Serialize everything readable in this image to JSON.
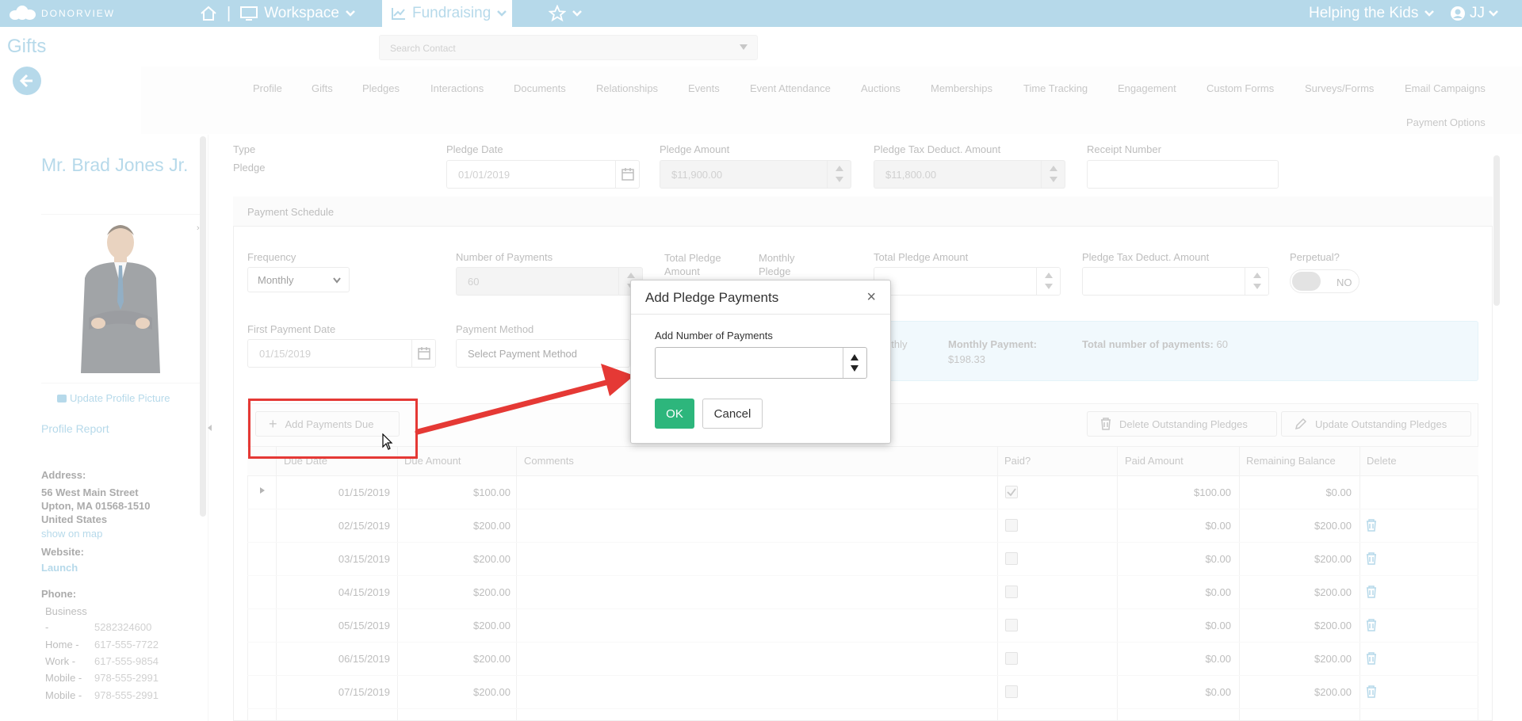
{
  "topnav": {
    "logo_text": "DONORVIEW",
    "home_sep": "|",
    "workspace": "Workspace",
    "fundraising": "Fundraising",
    "org": "Helping the Kids",
    "user": "JJ"
  },
  "page": {
    "title": "Gifts"
  },
  "search": {
    "placeholder": "Search Contact"
  },
  "tabs": [
    "Profile",
    "Gifts",
    "Pledges",
    "Interactions",
    "Documents",
    "Relationships",
    "Events",
    "Event Attendance",
    "Auctions",
    "Memberships",
    "Time Tracking",
    "Engagement",
    "Custom Forms",
    "Surveys/Forms",
    "Email Campaigns",
    "Payment Options"
  ],
  "sidebar": {
    "name": "Mr. Brad Jones Jr.",
    "update_pic": "Update Profile Picture",
    "profile_report": "Profile Report",
    "address_label": "Address:",
    "address_line1": "56 West Main Street",
    "address_line2": "Upton, MA 01568-1510",
    "address_line3": "United States",
    "show_map": "show on map",
    "website_label": "Website:",
    "website_link": "Launch",
    "phone_label": "Phone:",
    "phones": [
      {
        "type": "Business",
        "number": ""
      },
      {
        "type": "-",
        "number": "5282324600"
      },
      {
        "type": "Home -",
        "number": "617-555-7722"
      },
      {
        "type": "Work -",
        "number": "617-555-9854"
      },
      {
        "type": "Mobile -",
        "number": "978-555-2991"
      },
      {
        "type": "Mobile -",
        "number": "978-555-2991"
      }
    ]
  },
  "form": {
    "type_label": "Type",
    "type_value": "Pledge",
    "pledge_date_label": "Pledge Date",
    "pledge_date": "01/01/2019",
    "pledge_amount_label": "Pledge Amount",
    "pledge_amount": "$11,900.00",
    "tax_label": "Pledge Tax Deduct. Amount",
    "tax_amount": "$11,800.00",
    "receipt_label": "Receipt Number"
  },
  "schedule": {
    "header": "Payment Schedule",
    "frequency_label": "Frequency",
    "frequency": "Monthly",
    "num_payments_label": "Number of Payments",
    "num_payments": "60",
    "total_pledge_amount_small": "Total Pledge Amount",
    "monthly_pledge_small": "Monthly Pledge",
    "total_pledge_amount_label": "Total Pledge Amount",
    "tax_label": "Pledge Tax Deduct. Amount",
    "perpetual_label": "Perpetual?",
    "perpetual_value": "NO",
    "first_payment_label": "First Payment Date",
    "first_payment": "01/15/2019",
    "payment_method_label": "Payment Method",
    "payment_method": "Select Payment Method",
    "info_partial": "nthly",
    "monthly_payment_label": "Monthly Payment:",
    "monthly_payment": "$198.33",
    "total_payments_label": "Total number of payments:",
    "total_payments": "60"
  },
  "actions": {
    "add_due": "Add Payments Due",
    "delete_outstanding": "Delete Outstanding Pledges",
    "update_outstanding": "Update Outstanding Pledges"
  },
  "grid": {
    "headers": [
      "Due Date",
      "Due Amount",
      "Comments",
      "Paid?",
      "Paid Amount",
      "Remaining Balance",
      "Delete"
    ],
    "rows": [
      {
        "date": "01/15/2019",
        "amount": "$100.00",
        "paid": true,
        "paid_amount": "$100.00",
        "balance": "$0.00"
      },
      {
        "date": "02/15/2019",
        "amount": "$200.00",
        "paid": false,
        "paid_amount": "$0.00",
        "balance": "$200.00"
      },
      {
        "date": "03/15/2019",
        "amount": "$200.00",
        "paid": false,
        "paid_amount": "$0.00",
        "balance": "$200.00"
      },
      {
        "date": "04/15/2019",
        "amount": "$200.00",
        "paid": false,
        "paid_amount": "$0.00",
        "balance": "$200.00"
      },
      {
        "date": "05/15/2019",
        "amount": "$200.00",
        "paid": false,
        "paid_amount": "$0.00",
        "balance": "$200.00"
      },
      {
        "date": "06/15/2019",
        "amount": "$200.00",
        "paid": false,
        "paid_amount": "$0.00",
        "balance": "$200.00"
      },
      {
        "date": "07/15/2019",
        "amount": "$200.00",
        "paid": false,
        "paid_amount": "$0.00",
        "balance": "$200.00"
      }
    ]
  },
  "modal": {
    "title": "Add Pledge Payments",
    "close": "×",
    "field_label": "Add Number of Payments",
    "ok": "OK",
    "cancel": "Cancel"
  },
  "colors": {
    "brand": "#7bbbd9",
    "ok": "#2db67c",
    "annotation": "#e53935"
  }
}
